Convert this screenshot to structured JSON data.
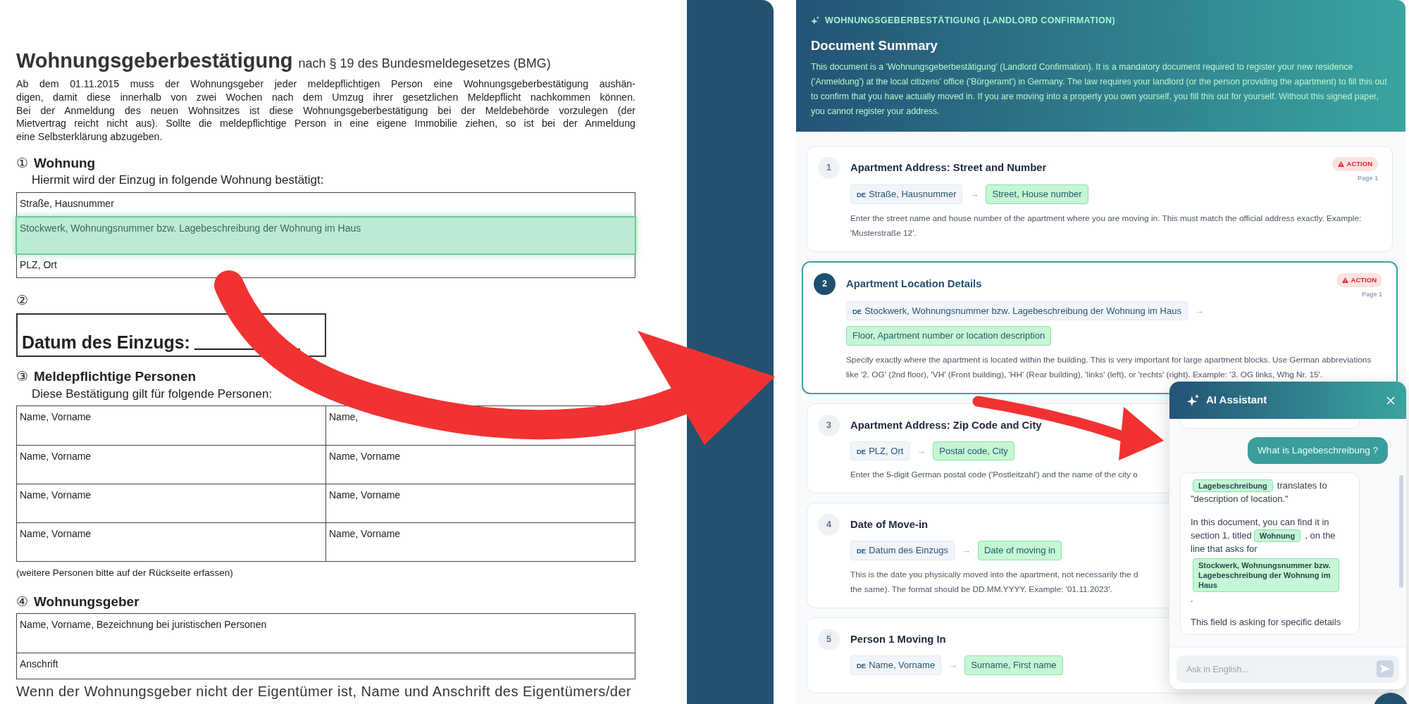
{
  "document": {
    "title": "Wohnungsgeberbestätigung",
    "title_suffix": "nach § 19 des Bundesmeldegesetzes (BMG)",
    "intro_lines": [
      "Ab dem 01.11.2015 muss der Wohnungsgeber jeder meldepflichtigen Person eine Wohnungsgeberbestätigung aushän-",
      "digen, damit diese innerhalb von zwei Wochen nach dem Umzug ihrer gesetzlichen Meldepflicht nachkommen können.",
      "Bei der Anmeldung des neuen Wohnsitzes ist diese Wohnungsgeberbestätigung bei der Meldebehörde vorzulegen (der",
      "Mietvertrag reicht nicht aus). Sollte die meldepflichtige Person in eine eigene Immobilie ziehen, so ist bei der Anmeldung",
      "eine Selbsterklärung abzugeben."
    ],
    "sections": [
      {
        "kind": "fields",
        "number": "①",
        "title": "Wohnung",
        "subtitle": "Hiermit wird der Einzug in folgende Wohnung bestätigt:",
        "rows": [
          {
            "cells": [
              {
                "label": "Straße, Hausnummer",
                "highlighted": false
              }
            ]
          },
          {
            "cells": [
              {
                "label": "Stockwerk, Wohnungsnummer bzw. Lagebeschreibung der Wohnung im Haus",
                "highlighted": true
              }
            ]
          },
          {
            "cells": [
              {
                "label": "PLZ, Ort",
                "highlighted": false
              }
            ]
          }
        ]
      },
      {
        "kind": "date",
        "number": "②",
        "label": "Datum des Einzugs:"
      },
      {
        "kind": "fields",
        "number": "③",
        "title": "Meldepflichtige Personen",
        "subtitle": "Diese Bestätigung gilt für folgende Personen:",
        "rows": [
          {
            "cells": [
              {
                "label": "Name, Vorname",
                "highlighted": false
              },
              {
                "label": "Name,",
                "highlighted": false
              }
            ]
          },
          {
            "cells": [
              {
                "label": "Name, Vorname",
                "highlighted": false
              },
              {
                "label": "Name, Vorname",
                "highlighted": false
              }
            ]
          },
          {
            "cells": [
              {
                "label": "Name, Vorname",
                "highlighted": false
              },
              {
                "label": "Name, Vorname",
                "highlighted": false
              }
            ]
          },
          {
            "cells": [
              {
                "label": "Name, Vorname",
                "highlighted": false
              },
              {
                "label": "Name, Vorname",
                "highlighted": false
              }
            ]
          }
        ],
        "note": "(weitere Personen bitte auf der Rückseite erfassen)"
      },
      {
        "kind": "fields",
        "number": "④",
        "title": "Wohnungsgeber",
        "rows": [
          {
            "cells": [
              {
                "label": "Name, Vorname, Bezeichnung bei juristischen Personen",
                "highlighted": false
              }
            ]
          },
          {
            "cells": [
              {
                "label": "Anschrift",
                "highlighted": false
              }
            ]
          }
        ]
      }
    ],
    "footer_text": "Wenn der Wohnungsgeber nicht der Eigentümer ist, Name und Anschrift des Eigentümers/der"
  },
  "summary": {
    "label": "WOHNUNGSGEBERBESTÄTIGUNG (LANDLORD CONFIRMATION)",
    "title": "Document Summary",
    "text": "This document is a 'Wohnungsgeberbestätigung' (Landlord Confirmation). It is a mandatory document required to register your new residence ('Anmeldung') at the local citizens' office ('Bürgeramt') in Germany. The law requires your landlord (or the person providing the apartment) to fill this out to confirm that you have actually moved in. If you are moving into a property you own yourself, you fill this out for yourself. Without this signed paper, you cannot register your address."
  },
  "cards": [
    {
      "number": "1",
      "title": "Apartment Address: Street and Number",
      "selected": false,
      "badge": "ACTION",
      "page": "Page 1",
      "lang": "DE",
      "original": "Straße, Hausnummer",
      "arrow": "→",
      "translation": "Street, House number",
      "description": [
        "Enter the street name and house number of the apartment where you are moving in. This must match the official address exactly. Example: 'Musterstraße 12'."
      ]
    },
    {
      "number": "2",
      "title": "Apartment Location Details",
      "selected": true,
      "badge": "ACTION",
      "page": "Page 1",
      "lang": "DE",
      "original": "Stockwerk, Wohnungsnummer bzw. Lagebeschreibung der Wohnung im Haus",
      "arrow": "→",
      "translation": "Floor, Apartment number or location description",
      "description": [
        "Specify exactly where the apartment is located within the building. This is very important for large apartment blocks. Use German abbreviations like '2. OG' (2nd floor), 'VH' (Front building), 'HH' (Rear building), 'links' (left), or 'rechts' (right). Example: '3. OG links, Whg Nr. 15'."
      ]
    },
    {
      "number": "3",
      "title": "Apartment Address: Zip Code and City",
      "selected": false,
      "lang": "DE",
      "original": "PLZ, Ort",
      "arrow": "→",
      "translation": "Postal code, City",
      "description": [
        "Enter the 5-digit German postal code ('Postleitzahl') and the name of the city o"
      ]
    },
    {
      "number": "4",
      "title": "Date of Move-in",
      "selected": false,
      "lang": "DE",
      "original": "Datum des Einzugs",
      "arrow": "→",
      "translation": "Date of moving in",
      "description": [
        "This is the date you physically moved into the apartment, not necessarily the d",
        "the same). The format should be DD.MM.YYYY. Example: '01.11.2023'."
      ]
    },
    {
      "number": "5",
      "title": "Person 1 Moving In",
      "selected": false,
      "lang": "DE",
      "original": "Name, Vorname",
      "arrow": "→",
      "translation": "Surname, First name"
    }
  ],
  "assistant": {
    "title": "AI Assistant",
    "messages": [
      {
        "kind": "bot"
      },
      {
        "kind": "user",
        "text": "What is Lagebeschreibung ?"
      },
      {
        "kind": "bot",
        "parts": [
          {
            "kind": "tag",
            "text": "Lagebeschreibung"
          },
          {
            "kind": "text",
            "text": "translates to \"description of location.\""
          },
          {
            "kind": "gap"
          },
          {
            "kind": "text",
            "text": "In this document, you can find it in section 1, titled"
          },
          {
            "kind": "tag",
            "text": "Wohnung"
          },
          {
            "kind": "text",
            "text": ", on the line that asks for"
          },
          {
            "kind": "block_tag",
            "text": "Stockwerk, Wohnungsnummer bzw. Lagebeschreibung der Wohnung im Haus"
          },
          {
            "kind": "text",
            "text": "."
          },
          {
            "kind": "gap"
          },
          {
            "kind": "text",
            "text": "This field is asking for specific details"
          }
        ]
      }
    ],
    "placeholder": "Ask in English..."
  }
}
